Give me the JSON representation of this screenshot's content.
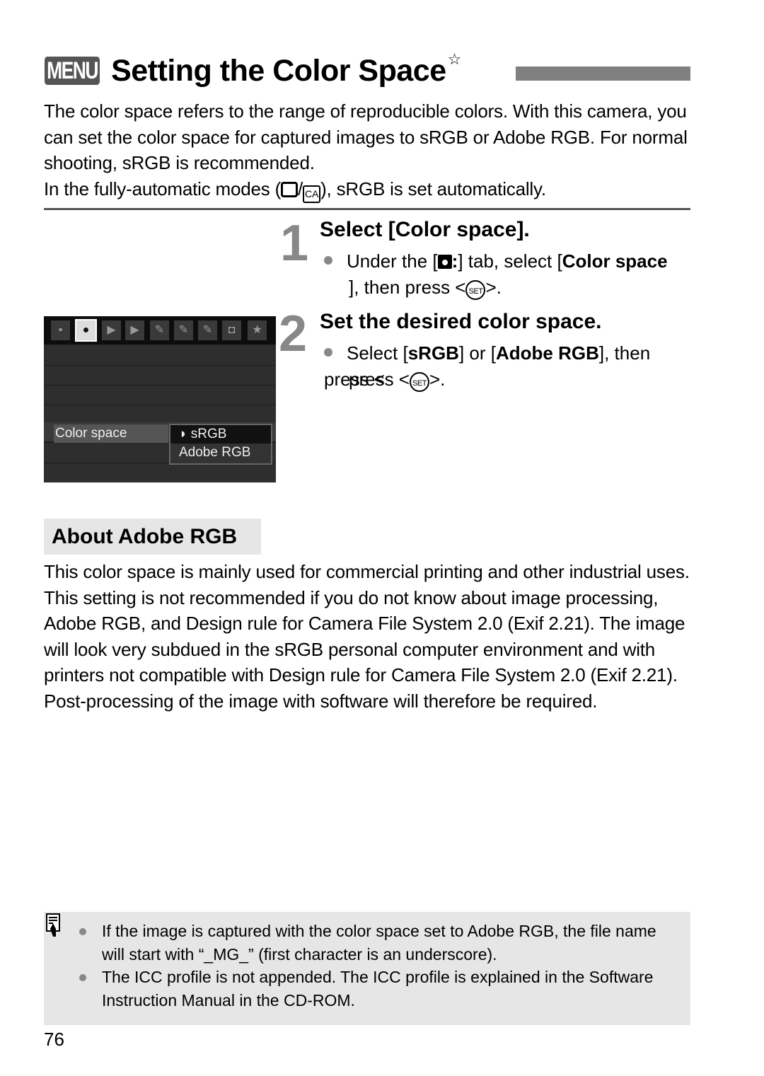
{
  "header": {
    "menu_badge": "MENU",
    "title": "Setting the Color Space",
    "title_star": "☆"
  },
  "intro": {
    "paragraph": "The color space refers to the range of reproducible colors. With this camera, you can set the color space for captured images to sRGB or Adobe RGB. For normal shooting, sRGB is recommended.",
    "auto_prefix": "In the fully-automatic modes (",
    "auto_sep": "/",
    "ca_icon": "CA",
    "auto_suffix": "), sRGB is set automatically."
  },
  "steps": [
    {
      "number": "1",
      "heading": "Select [Color space].",
      "body_pre": "Under the [",
      "body_mid": "] tab, select [",
      "body_bold": "Color space",
      "body_post": "], then press <",
      "set_icon": "SET",
      "body_end": ">."
    },
    {
      "number": "2",
      "heading": "Set the desired color space.",
      "body_pre": "Select [",
      "bold1": "sRGB",
      "mid": "] or [",
      "bold2": "Adobe RGB",
      "post": "], then press <",
      "set_icon": "SET",
      "body_end": ">."
    }
  ],
  "lcd": {
    "tabs": [
      "▪",
      "●",
      "▶",
      "▶",
      "✎",
      "✎",
      "✎",
      "◘",
      "★"
    ],
    "active_tab_index": 1,
    "setting_label": "Color space",
    "options": [
      "sRGB",
      "Adobe RGB"
    ],
    "selected_option": "sRGB",
    "selector_glyph": "◗"
  },
  "about": {
    "heading": "About Adobe RGB",
    "body": "This color space is mainly used for commercial printing and other industrial uses. This setting is not recommended if you do not know about image processing, Adobe RGB, and Design rule for Camera File System 2.0 (Exif 2.21). The image will look very subdued in the sRGB personal computer environment and with printers not compatible with Design rule for Camera File System 2.0 (Exif 2.21). Post-processing of the image with software will therefore be required."
  },
  "notes": {
    "icon": "note-icon",
    "items": [
      "If the image is captured with the color space set to Adobe RGB, the file name will start with “_MG_” (first character is an underscore).",
      "The ICC profile is not appended. The ICC profile is explained in the Software Instruction Manual in the CD-ROM."
    ]
  },
  "footer": {
    "page_number": "76"
  }
}
